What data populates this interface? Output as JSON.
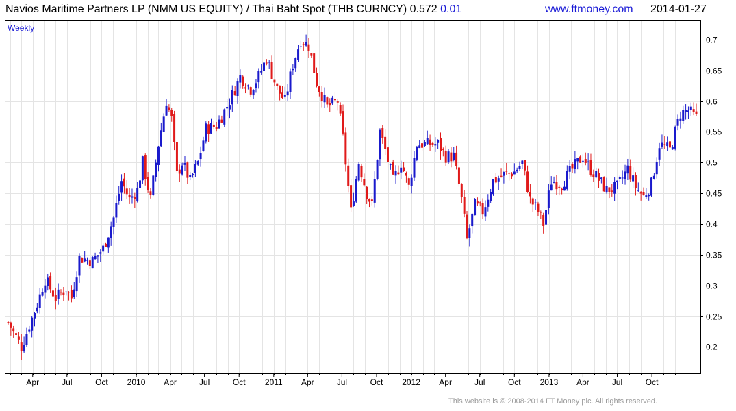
{
  "header": {
    "title": "Navios Maritime Partners LP (NMM US EQUITY) / Thai Baht Spot (THB CURNCY) 0.572",
    "change": "0.01",
    "site": "www.ftmoney.com",
    "date": "2014-01-27"
  },
  "footer": {
    "copyright": "This website is © 2008-2014 FT Money plc. All rights reserved."
  },
  "colors": {
    "up": "#1a1acc",
    "down": "#e01a1a",
    "grid": "#e4e4e4",
    "axis": "#000000",
    "link": "#1a1ad6"
  },
  "chart_data": {
    "type": "candlestick",
    "period_label": "Weekly",
    "x_axis": {
      "range": [
        "2009-01-26",
        "2014-01-27"
      ],
      "ticks": [
        {
          "date": "2009-04-01",
          "label": "Apr"
        },
        {
          "date": "2009-07-01",
          "label": "Jul"
        },
        {
          "date": "2009-10-01",
          "label": "Oct"
        },
        {
          "date": "2010-01-01",
          "label": "2010"
        },
        {
          "date": "2010-04-01",
          "label": "Apr"
        },
        {
          "date": "2010-07-01",
          "label": "Jul"
        },
        {
          "date": "2010-10-01",
          "label": "Oct"
        },
        {
          "date": "2011-01-01",
          "label": "2011"
        },
        {
          "date": "2011-04-01",
          "label": "Apr"
        },
        {
          "date": "2011-07-01",
          "label": "Jul"
        },
        {
          "date": "2011-10-01",
          "label": "Oct"
        },
        {
          "date": "2012-01-01",
          "label": "2012"
        },
        {
          "date": "2012-04-01",
          "label": "Apr"
        },
        {
          "date": "2012-07-01",
          "label": "Jul"
        },
        {
          "date": "2012-10-01",
          "label": "Oct"
        },
        {
          "date": "2013-01-01",
          "label": "2013"
        },
        {
          "date": "2013-04-01",
          "label": "Apr"
        },
        {
          "date": "2013-07-01",
          "label": "Jul"
        },
        {
          "date": "2013-10-01",
          "label": "Oct"
        }
      ]
    },
    "y_axis": {
      "ylim": [
        0.157,
        0.731
      ],
      "ticks": [
        0.2,
        0.25,
        0.3,
        0.35,
        0.4,
        0.45,
        0.5,
        0.55,
        0.6,
        0.65,
        0.7
      ],
      "tick_labels": [
        "0.2",
        "0.25",
        "0.3",
        "0.35",
        "0.4",
        "0.45",
        "0.5",
        "0.55",
        "0.6",
        "0.65",
        "0.7"
      ],
      "position": "right"
    },
    "close_series": [
      {
        "date": "2009-01-26",
        "close": 0.24
      },
      {
        "date": "2009-03-02",
        "close": 0.2
      },
      {
        "date": "2009-04-13",
        "close": 0.27
      },
      {
        "date": "2009-05-04",
        "close": 0.31
      },
      {
        "date": "2009-06-01",
        "close": 0.28
      },
      {
        "date": "2009-06-29",
        "close": 0.295
      },
      {
        "date": "2009-07-13",
        "close": 0.28
      },
      {
        "date": "2009-08-03",
        "close": 0.345
      },
      {
        "date": "2009-09-07",
        "close": 0.34
      },
      {
        "date": "2009-10-05",
        "close": 0.36
      },
      {
        "date": "2009-11-02",
        "close": 0.41
      },
      {
        "date": "2009-11-23",
        "close": 0.47
      },
      {
        "date": "2009-12-14",
        "close": 0.44
      },
      {
        "date": "2010-01-04",
        "close": 0.455
      },
      {
        "date": "2010-01-18",
        "close": 0.5
      },
      {
        "date": "2010-02-08",
        "close": 0.44
      },
      {
        "date": "2010-03-01",
        "close": 0.53
      },
      {
        "date": "2010-03-22",
        "close": 0.6
      },
      {
        "date": "2010-04-05",
        "close": 0.57
      },
      {
        "date": "2010-04-19",
        "close": 0.48
      },
      {
        "date": "2010-05-03",
        "close": 0.5
      },
      {
        "date": "2010-05-24",
        "close": 0.47
      },
      {
        "date": "2010-06-14",
        "close": 0.5
      },
      {
        "date": "2010-07-05",
        "close": 0.555
      },
      {
        "date": "2010-08-02",
        "close": 0.56
      },
      {
        "date": "2010-09-06",
        "close": 0.6
      },
      {
        "date": "2010-10-04",
        "close": 0.64
      },
      {
        "date": "2010-11-01",
        "close": 0.62
      },
      {
        "date": "2010-11-22",
        "close": 0.64
      },
      {
        "date": "2010-12-13",
        "close": 0.67
      },
      {
        "date": "2011-01-10",
        "close": 0.62
      },
      {
        "date": "2011-01-31",
        "close": 0.6
      },
      {
        "date": "2011-02-21",
        "close": 0.66
      },
      {
        "date": "2011-03-14",
        "close": 0.7
      },
      {
        "date": "2011-04-04",
        "close": 0.69
      },
      {
        "date": "2011-04-25",
        "close": 0.63
      },
      {
        "date": "2011-05-23",
        "close": 0.59
      },
      {
        "date": "2011-06-20",
        "close": 0.6
      },
      {
        "date": "2011-07-04",
        "close": 0.54
      },
      {
        "date": "2011-07-25",
        "close": 0.42
      },
      {
        "date": "2011-08-15",
        "close": 0.5
      },
      {
        "date": "2011-09-05",
        "close": 0.45
      },
      {
        "date": "2011-09-19",
        "close": 0.43
      },
      {
        "date": "2011-10-10",
        "close": 0.55
      },
      {
        "date": "2011-10-24",
        "close": 0.52
      },
      {
        "date": "2011-11-14",
        "close": 0.47
      },
      {
        "date": "2011-12-05",
        "close": 0.5
      },
      {
        "date": "2011-12-26",
        "close": 0.46
      },
      {
        "date": "2012-01-16",
        "close": 0.53
      },
      {
        "date": "2012-02-13",
        "close": 0.53
      },
      {
        "date": "2012-03-12",
        "close": 0.53
      },
      {
        "date": "2012-04-02",
        "close": 0.51
      },
      {
        "date": "2012-04-23",
        "close": 0.51
      },
      {
        "date": "2012-05-14",
        "close": 0.44
      },
      {
        "date": "2012-05-28",
        "close": 0.375
      },
      {
        "date": "2012-06-18",
        "close": 0.43
      },
      {
        "date": "2012-07-09",
        "close": 0.42
      },
      {
        "date": "2012-08-06",
        "close": 0.47
      },
      {
        "date": "2012-09-03",
        "close": 0.48
      },
      {
        "date": "2012-10-01",
        "close": 0.485
      },
      {
        "date": "2012-10-22",
        "close": 0.5
      },
      {
        "date": "2012-11-12",
        "close": 0.44
      },
      {
        "date": "2012-12-03",
        "close": 0.42
      },
      {
        "date": "2012-12-17",
        "close": 0.4
      },
      {
        "date": "2013-01-07",
        "close": 0.47
      },
      {
        "date": "2013-02-04",
        "close": 0.465
      },
      {
        "date": "2013-03-04",
        "close": 0.49
      },
      {
        "date": "2013-04-01",
        "close": 0.51
      },
      {
        "date": "2013-04-15",
        "close": 0.495
      },
      {
        "date": "2013-06-03",
        "close": 0.455
      },
      {
        "date": "2013-07-01",
        "close": 0.46
      },
      {
        "date": "2013-07-29",
        "close": 0.49
      },
      {
        "date": "2013-08-19",
        "close": 0.46
      },
      {
        "date": "2013-09-09",
        "close": 0.445
      },
      {
        "date": "2013-09-30",
        "close": 0.465
      },
      {
        "date": "2013-10-21",
        "close": 0.53
      },
      {
        "date": "2013-11-18",
        "close": 0.52
      },
      {
        "date": "2013-12-16",
        "close": 0.58
      },
      {
        "date": "2014-01-06",
        "close": 0.585
      },
      {
        "date": "2014-01-27",
        "close": 0.572
      }
    ]
  }
}
